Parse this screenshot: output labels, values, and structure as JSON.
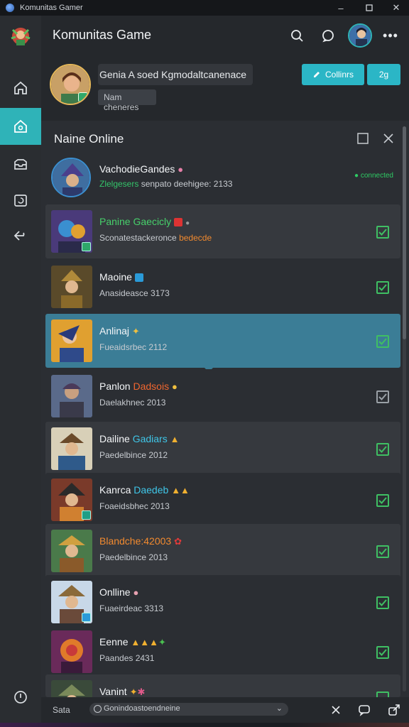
{
  "window": {
    "title": "Komunitas Gamer"
  },
  "header": {
    "title": "Komunitas Game"
  },
  "profile": {
    "status": "Genia A soed Kgmodaltcanenace",
    "chip": "Nam cheneres",
    "buttons": {
      "primary_label": "Collinrs",
      "secondary_label": "2g"
    }
  },
  "panel": {
    "title": "Naine Online"
  },
  "featured": {
    "name": "VachodieGandes",
    "sub_green": "Zlelgesers",
    "sub_rest": " senpato deehigee: 2133",
    "status": "● connected"
  },
  "friends": [
    {
      "name": "Panine Gaecicly",
      "sub": "Sconatestackeronce ",
      "sub_accent": "bedecde"
    },
    {
      "name": "Maoine",
      "sub": "Anasideasce 3173"
    },
    {
      "name": "Anlinaj",
      "sub": "Fueaidsrbec 2112"
    },
    {
      "name": "Panlon ",
      "name_accent": "Dadsois",
      "sub": "Daelakhnec 2013"
    },
    {
      "name": "Dailine ",
      "name_accent": "Gadiars",
      "sub": "Paedelbince 2012"
    },
    {
      "name": "Kanrca ",
      "name_accent": "Daedeb",
      "sub": "Foaeidsbhec 2013"
    },
    {
      "name": "Blandche:42003",
      "sub": "Paedelbince 2013"
    },
    {
      "name": "Onlline",
      "sub": "Fuaeirdeac 3313"
    },
    {
      "name": "Eenne",
      "sub": "Paandes 2431"
    },
    {
      "name": "Vanint",
      "sub": ""
    }
  ],
  "footer": {
    "label": "Sata",
    "select_value": "Gonindoastoendneine"
  },
  "colors": {
    "accent": "#2fb3b8",
    "online": "#3fbf63",
    "selected_row": "#3b7d96"
  }
}
